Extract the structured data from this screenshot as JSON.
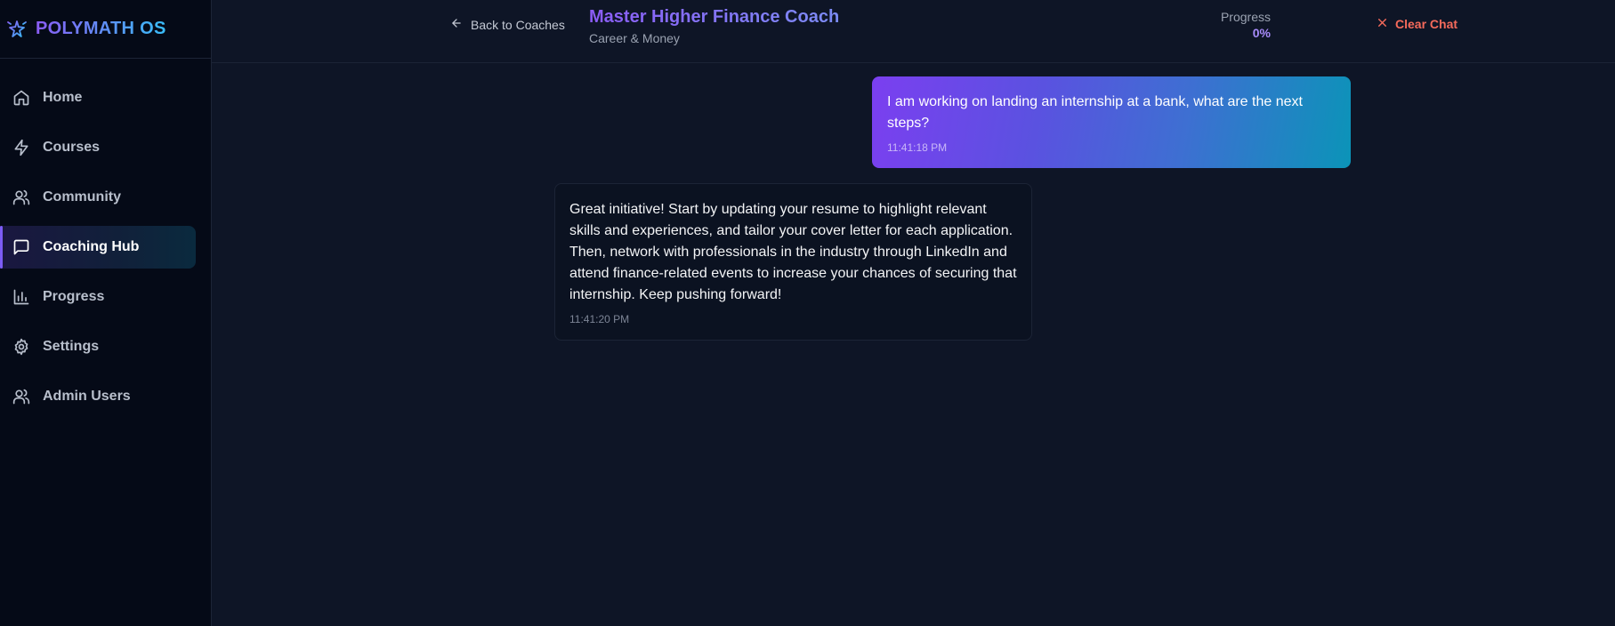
{
  "brand": {
    "name": "POLYMATH OS",
    "icon": "sparkle-star-icon"
  },
  "sidebar": {
    "items": [
      {
        "label": "Home",
        "icon": "home-icon",
        "active": false
      },
      {
        "label": "Courses",
        "icon": "lightning-icon",
        "active": false
      },
      {
        "label": "Community",
        "icon": "users-icon",
        "active": false
      },
      {
        "label": "Coaching Hub",
        "icon": "chat-bubble-icon",
        "active": true
      },
      {
        "label": "Progress",
        "icon": "bar-chart-icon",
        "active": false
      },
      {
        "label": "Settings",
        "icon": "gear-icon",
        "active": false
      },
      {
        "label": "Admin Users",
        "icon": "users-icon",
        "active": false
      }
    ]
  },
  "header": {
    "back_label": "Back to Coaches",
    "coach_name": "Master Higher Finance Coach",
    "coach_category": "Career & Money",
    "progress_label": "Progress",
    "progress_value": "0%",
    "clear_label": "Clear Chat"
  },
  "messages": [
    {
      "role": "user",
      "text": "I am working on landing an internship at a bank, what are the next steps?",
      "time": "11:41:18 PM"
    },
    {
      "role": "coach",
      "text": "Great initiative! Start by updating your resume to highlight relevant skills and experiences, and tailor your cover letter for each application. Then, network with professionals in the industry through LinkedIn and attend finance-related events to increase your chances of securing that internship. Keep pushing forward!",
      "time": "11:41:20 PM"
    }
  ],
  "colors": {
    "accent_purple": "#7c5cf5",
    "accent_cyan": "#0b94b8",
    "danger": "#f56a5b",
    "background": "#0e1526",
    "sidebar_bg": "#050a17"
  }
}
